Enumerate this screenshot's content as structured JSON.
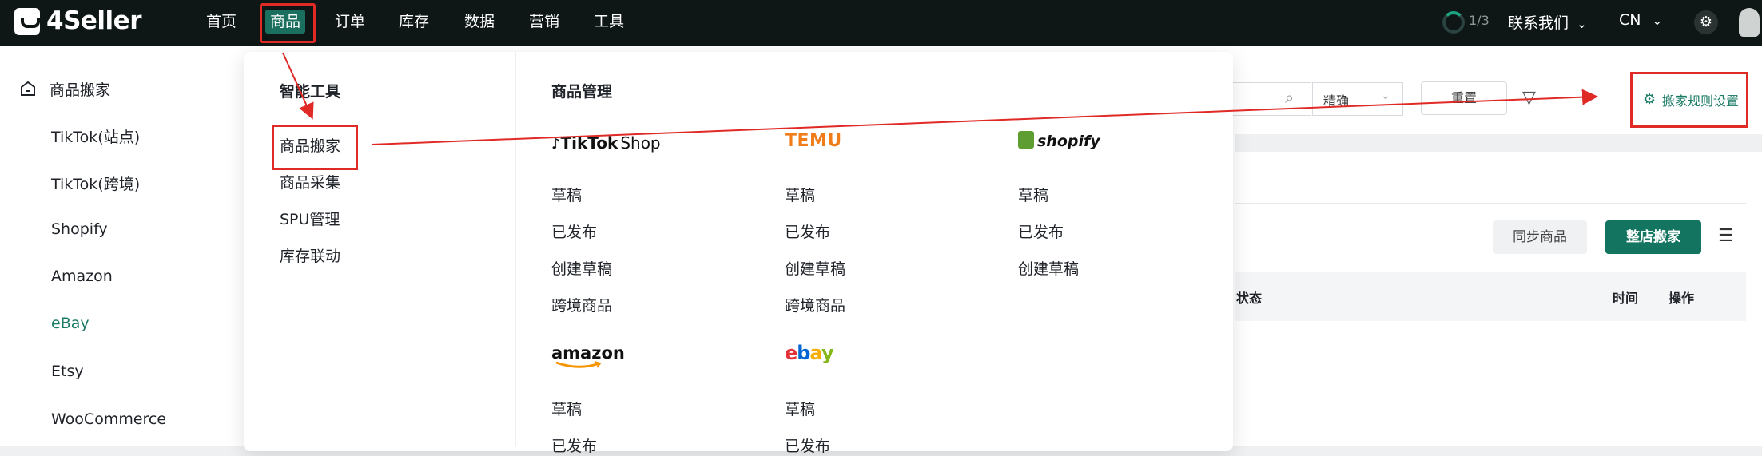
{
  "app": {
    "logo_text": "4Seller",
    "nav": [
      "首页",
      "商品",
      "订单",
      "库存",
      "数据",
      "营销",
      "工具"
    ],
    "active_nav_index": 1,
    "progress_text": "1/3",
    "contact_label": "联系我们",
    "lang_label": "CN",
    "chevron": "⌄"
  },
  "sidebar": {
    "title": "商品搬家",
    "items": [
      "TikTok(站点)",
      "TikTok(跨境)",
      "Shopify",
      "Amazon",
      "eBay",
      "Etsy",
      "WooCommerce"
    ],
    "active_index": 4,
    "accent": "#1a7a65"
  },
  "main": {
    "precise_label": "精确",
    "reset_label": "重置",
    "rule_label": "搬家规则设置",
    "sync_label": "同步商品",
    "shop_move_label": "整店搬家",
    "col_status": "状态",
    "col_time": "时间",
    "col_action": "操作"
  },
  "dropdown": {
    "tools_heading": "智能工具",
    "tools": [
      "商品搬家",
      "商品采集",
      "SPU管理",
      "库存联动"
    ],
    "manage_heading": "商品管理",
    "brands": {
      "tiktok": {
        "mark": "♪",
        "name": "TikTok",
        "suffix": "Shop",
        "items": [
          "草稿",
          "已发布",
          "创建草稿",
          "跨境商品"
        ]
      },
      "temu": {
        "name": "TEMU",
        "items": [
          "草稿",
          "已发布",
          "创建草稿",
          "跨境商品"
        ]
      },
      "shopify": {
        "name": "shopify",
        "items": [
          "草稿",
          "已发布",
          "创建草稿"
        ]
      },
      "amazon": {
        "name": "amazon",
        "items": [
          "草稿",
          "已发布"
        ]
      },
      "ebay": {
        "letters": [
          "e",
          "b",
          "a",
          "y"
        ],
        "colors": [
          "#e53238",
          "#0064d2",
          "#f5af02",
          "#86b817"
        ],
        "items": [
          "草稿",
          "已发布"
        ]
      }
    }
  },
  "annotation_color": "#e02a25"
}
